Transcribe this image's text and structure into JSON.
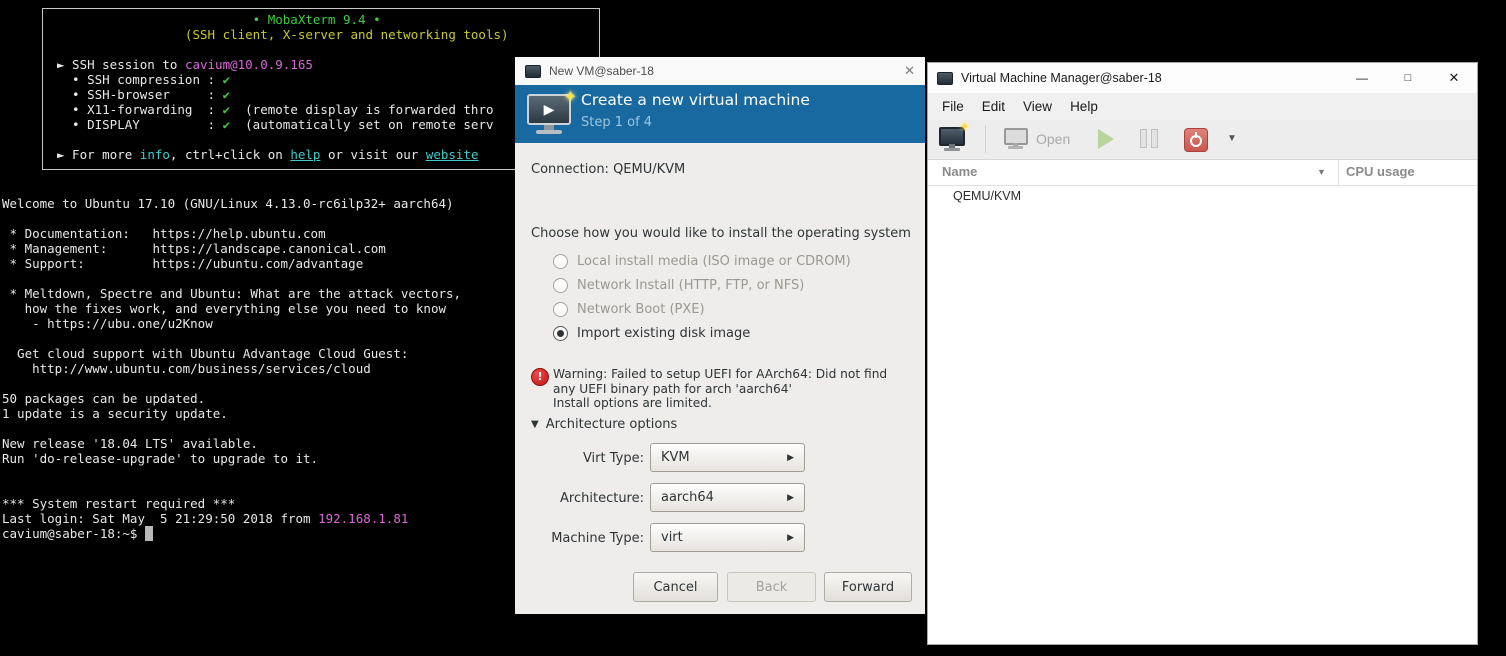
{
  "icons": {
    "close": "✕",
    "minimize": "—",
    "maximize": "□",
    "play": "▶",
    "caret_down": "▼",
    "sort_desc": "▼",
    "expander_down": "▼",
    "combo_arrow": "▶",
    "star": "✦",
    "warning_mark": "!"
  },
  "colors": {
    "terminal_green": "#3ecb3e",
    "terminal_yellow": "#c9c932",
    "terminal_magenta": "#d868d8",
    "terminal_cyan": "#3ecbcb",
    "dialog_header_blue": "#17699f",
    "power_red": "#c8584e",
    "play_green": "#aacd8b"
  },
  "terminal": {
    "banner_lines": [
      [
        [
          "g",
          "                          • MobaXterm 9.4 •"
        ]
      ],
      [
        [
          "y",
          "                 (SSH client, X-server and networking tools)"
        ]
      ],
      [
        [
          "d",
          ""
        ]
      ],
      [
        [
          "d",
          "► SSH session to "
        ],
        [
          "m",
          "cavium@10.0.9.165"
        ]
      ],
      [
        [
          "d",
          "  • SSH compression : "
        ],
        [
          "g",
          "✔"
        ]
      ],
      [
        [
          "d",
          "  • SSH-browser     : "
        ],
        [
          "g",
          "✔"
        ]
      ],
      [
        [
          "d",
          "  • X11-forwarding  : "
        ],
        [
          "g",
          "✔"
        ],
        [
          "d",
          "  (remote display is forwarded thro"
        ]
      ],
      [
        [
          "d",
          "  • DISPLAY         : "
        ],
        [
          "g",
          "✔"
        ],
        [
          "d",
          "  (automatically set on remote serv"
        ]
      ],
      [
        [
          "d",
          ""
        ]
      ],
      [
        [
          "d",
          "► For more "
        ],
        [
          "c",
          "info"
        ],
        [
          "d",
          ", ctrl+click on "
        ],
        [
          "cu",
          "help"
        ],
        [
          "d",
          " or visit our "
        ],
        [
          "cu",
          "website"
        ]
      ]
    ],
    "body_lines": [
      "Welcome to Ubuntu 17.10 (GNU/Linux 4.13.0-rc6ilp32+ aarch64)",
      "",
      " * Documentation:   https://help.ubuntu.com",
      " * Management:      https://landscape.canonical.com",
      " * Support:         https://ubuntu.com/advantage",
      "",
      " * Meltdown, Spectre and Ubuntu: What are the attack vectors,",
      "   how the fixes work, and everything else you need to know",
      "    - https://ubu.one/u2Know",
      "",
      "  Get cloud support with Ubuntu Advantage Cloud Guest:",
      "    http://www.ubuntu.com/business/services/cloud",
      "",
      "50 packages can be updated.",
      "1 update is a security update.",
      "",
      "New release '18.04 LTS' available.",
      "Run 'do-release-upgrade' to upgrade to it.",
      "",
      "",
      "*** System restart required ***",
      [
        [
          "d",
          "Last login: Sat May  5 21:29:50 2018 from "
        ],
        [
          "m",
          "192.168.1.81"
        ]
      ],
      [
        [
          "d",
          "cavium@saber-18:~$ "
        ],
        [
          "cur",
          " "
        ]
      ]
    ]
  },
  "dialog": {
    "title": "New VM@saber-18",
    "header_title": "Create a new virtual machine",
    "step_label": "Step 1 of 4",
    "connection_label": "Connection: QEMU/KVM",
    "choose_prompt": "Choose how you would like to install the operating system",
    "options": [
      {
        "label": "Local install media (ISO image or CDROM)"
      },
      {
        "label": "Network Install (HTTP, FTP, or NFS)"
      },
      {
        "label": "Network Boot (PXE)"
      },
      {
        "label": "Import existing disk image"
      }
    ],
    "warning_lines": [
      "Warning: Failed to setup UEFI for AArch64: Did not find",
      "any UEFI binary path for arch 'aarch64'",
      "Install options are limited."
    ],
    "expander_label": "Architecture options",
    "combos": [
      {
        "label": "Virt Type:",
        "value": "KVM"
      },
      {
        "label": "Architecture:",
        "value": "aarch64"
      },
      {
        "label": "Machine Type:",
        "value": "virt"
      }
    ],
    "buttons": {
      "cancel": "Cancel",
      "back": "Back",
      "forward": "Forward"
    }
  },
  "vmm": {
    "title": "Virtual Machine Manager@saber-18",
    "menus": [
      "File",
      "Edit",
      "View",
      "Help"
    ],
    "toolbar": {
      "open_label": "Open"
    },
    "columns": {
      "name": "Name",
      "cpu": "CPU usage"
    },
    "rows": [
      {
        "name": "QEMU/KVM"
      }
    ]
  }
}
